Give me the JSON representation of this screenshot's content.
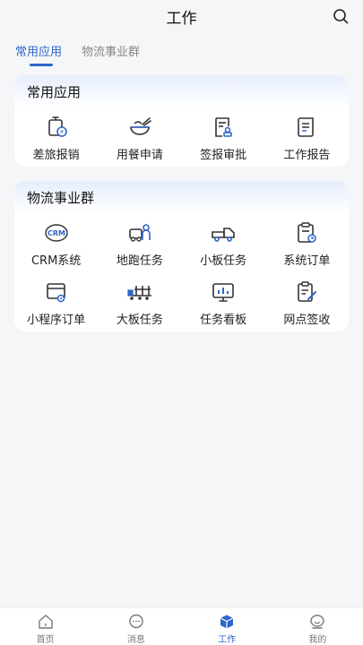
{
  "header": {
    "title": "工作",
    "search_icon": "search-icon"
  },
  "tabs": [
    {
      "label": "常用应用",
      "active": true
    },
    {
      "label": "物流事业群",
      "active": false
    }
  ],
  "common": {
    "title": "常用应用",
    "items": [
      {
        "label": "差旅报销",
        "icon": "travel-reimburse-icon"
      },
      {
        "label": "用餐申请",
        "icon": "meal-bowl-icon"
      },
      {
        "label": "签报审批",
        "icon": "approval-doc-icon"
      },
      {
        "label": "工作报告",
        "icon": "report-scroll-icon"
      }
    ]
  },
  "logistics": {
    "title": "物流事业群",
    "items": [
      {
        "label": "CRM系统",
        "icon": "crm-icon"
      },
      {
        "label": "地跑任务",
        "icon": "ground-delivery-icon"
      },
      {
        "label": "小板任务",
        "icon": "small-truck-icon"
      },
      {
        "label": "系统订单",
        "icon": "order-clipboard-icon"
      },
      {
        "label": "小程序订单",
        "icon": "mini-program-order-icon"
      },
      {
        "label": "大板任务",
        "icon": "large-truck-icon"
      },
      {
        "label": "任务看板",
        "icon": "dashboard-monitor-icon"
      },
      {
        "label": "网点签收",
        "icon": "sign-receipt-icon"
      }
    ]
  },
  "nav": [
    {
      "label": "首页",
      "icon": "home-icon",
      "active": false
    },
    {
      "label": "消息",
      "icon": "message-icon",
      "active": false
    },
    {
      "label": "工作",
      "icon": "work-cube-icon",
      "active": true
    },
    {
      "label": "我的",
      "icon": "profile-icon",
      "active": false
    }
  ],
  "colors": {
    "accent": "#2e66c9",
    "icon_stroke": "#333333",
    "background": "#f5f6f8"
  }
}
